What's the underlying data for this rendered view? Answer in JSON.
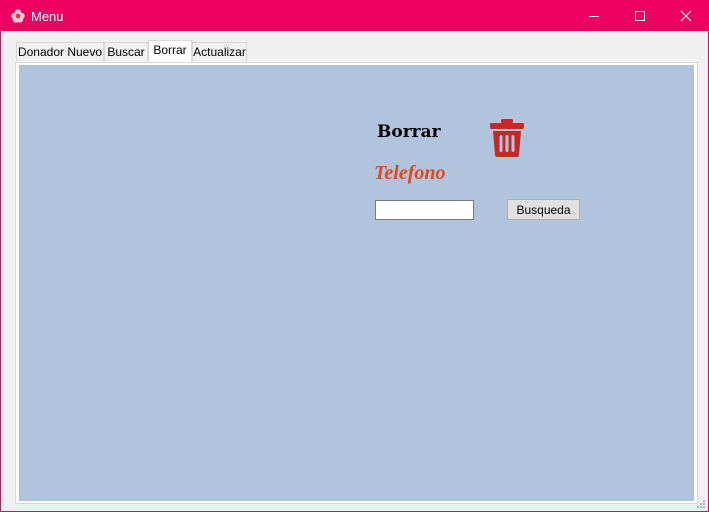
{
  "window": {
    "title": "Menu",
    "accent_color": "#ec0060",
    "icons": {
      "app": "flower-app-icon",
      "minimize": "minimize-icon",
      "maximize": "maximize-icon",
      "close": "close-icon"
    }
  },
  "tabs": [
    {
      "label": "Donador Nuevo",
      "active": false
    },
    {
      "label": "Buscar",
      "active": false
    },
    {
      "label": "Borrar",
      "active": true
    },
    {
      "label": "Actualizar",
      "active": false
    }
  ],
  "delete_panel": {
    "background": "#b0c4de",
    "heading": "Borrar",
    "trash_icon": "trash-icon",
    "trash_color": "#c62828",
    "field_label": "Telefono",
    "field_label_color": "#e0481a",
    "phone_input": {
      "value": "",
      "placeholder": ""
    },
    "search_button_label": "Busqueda"
  }
}
